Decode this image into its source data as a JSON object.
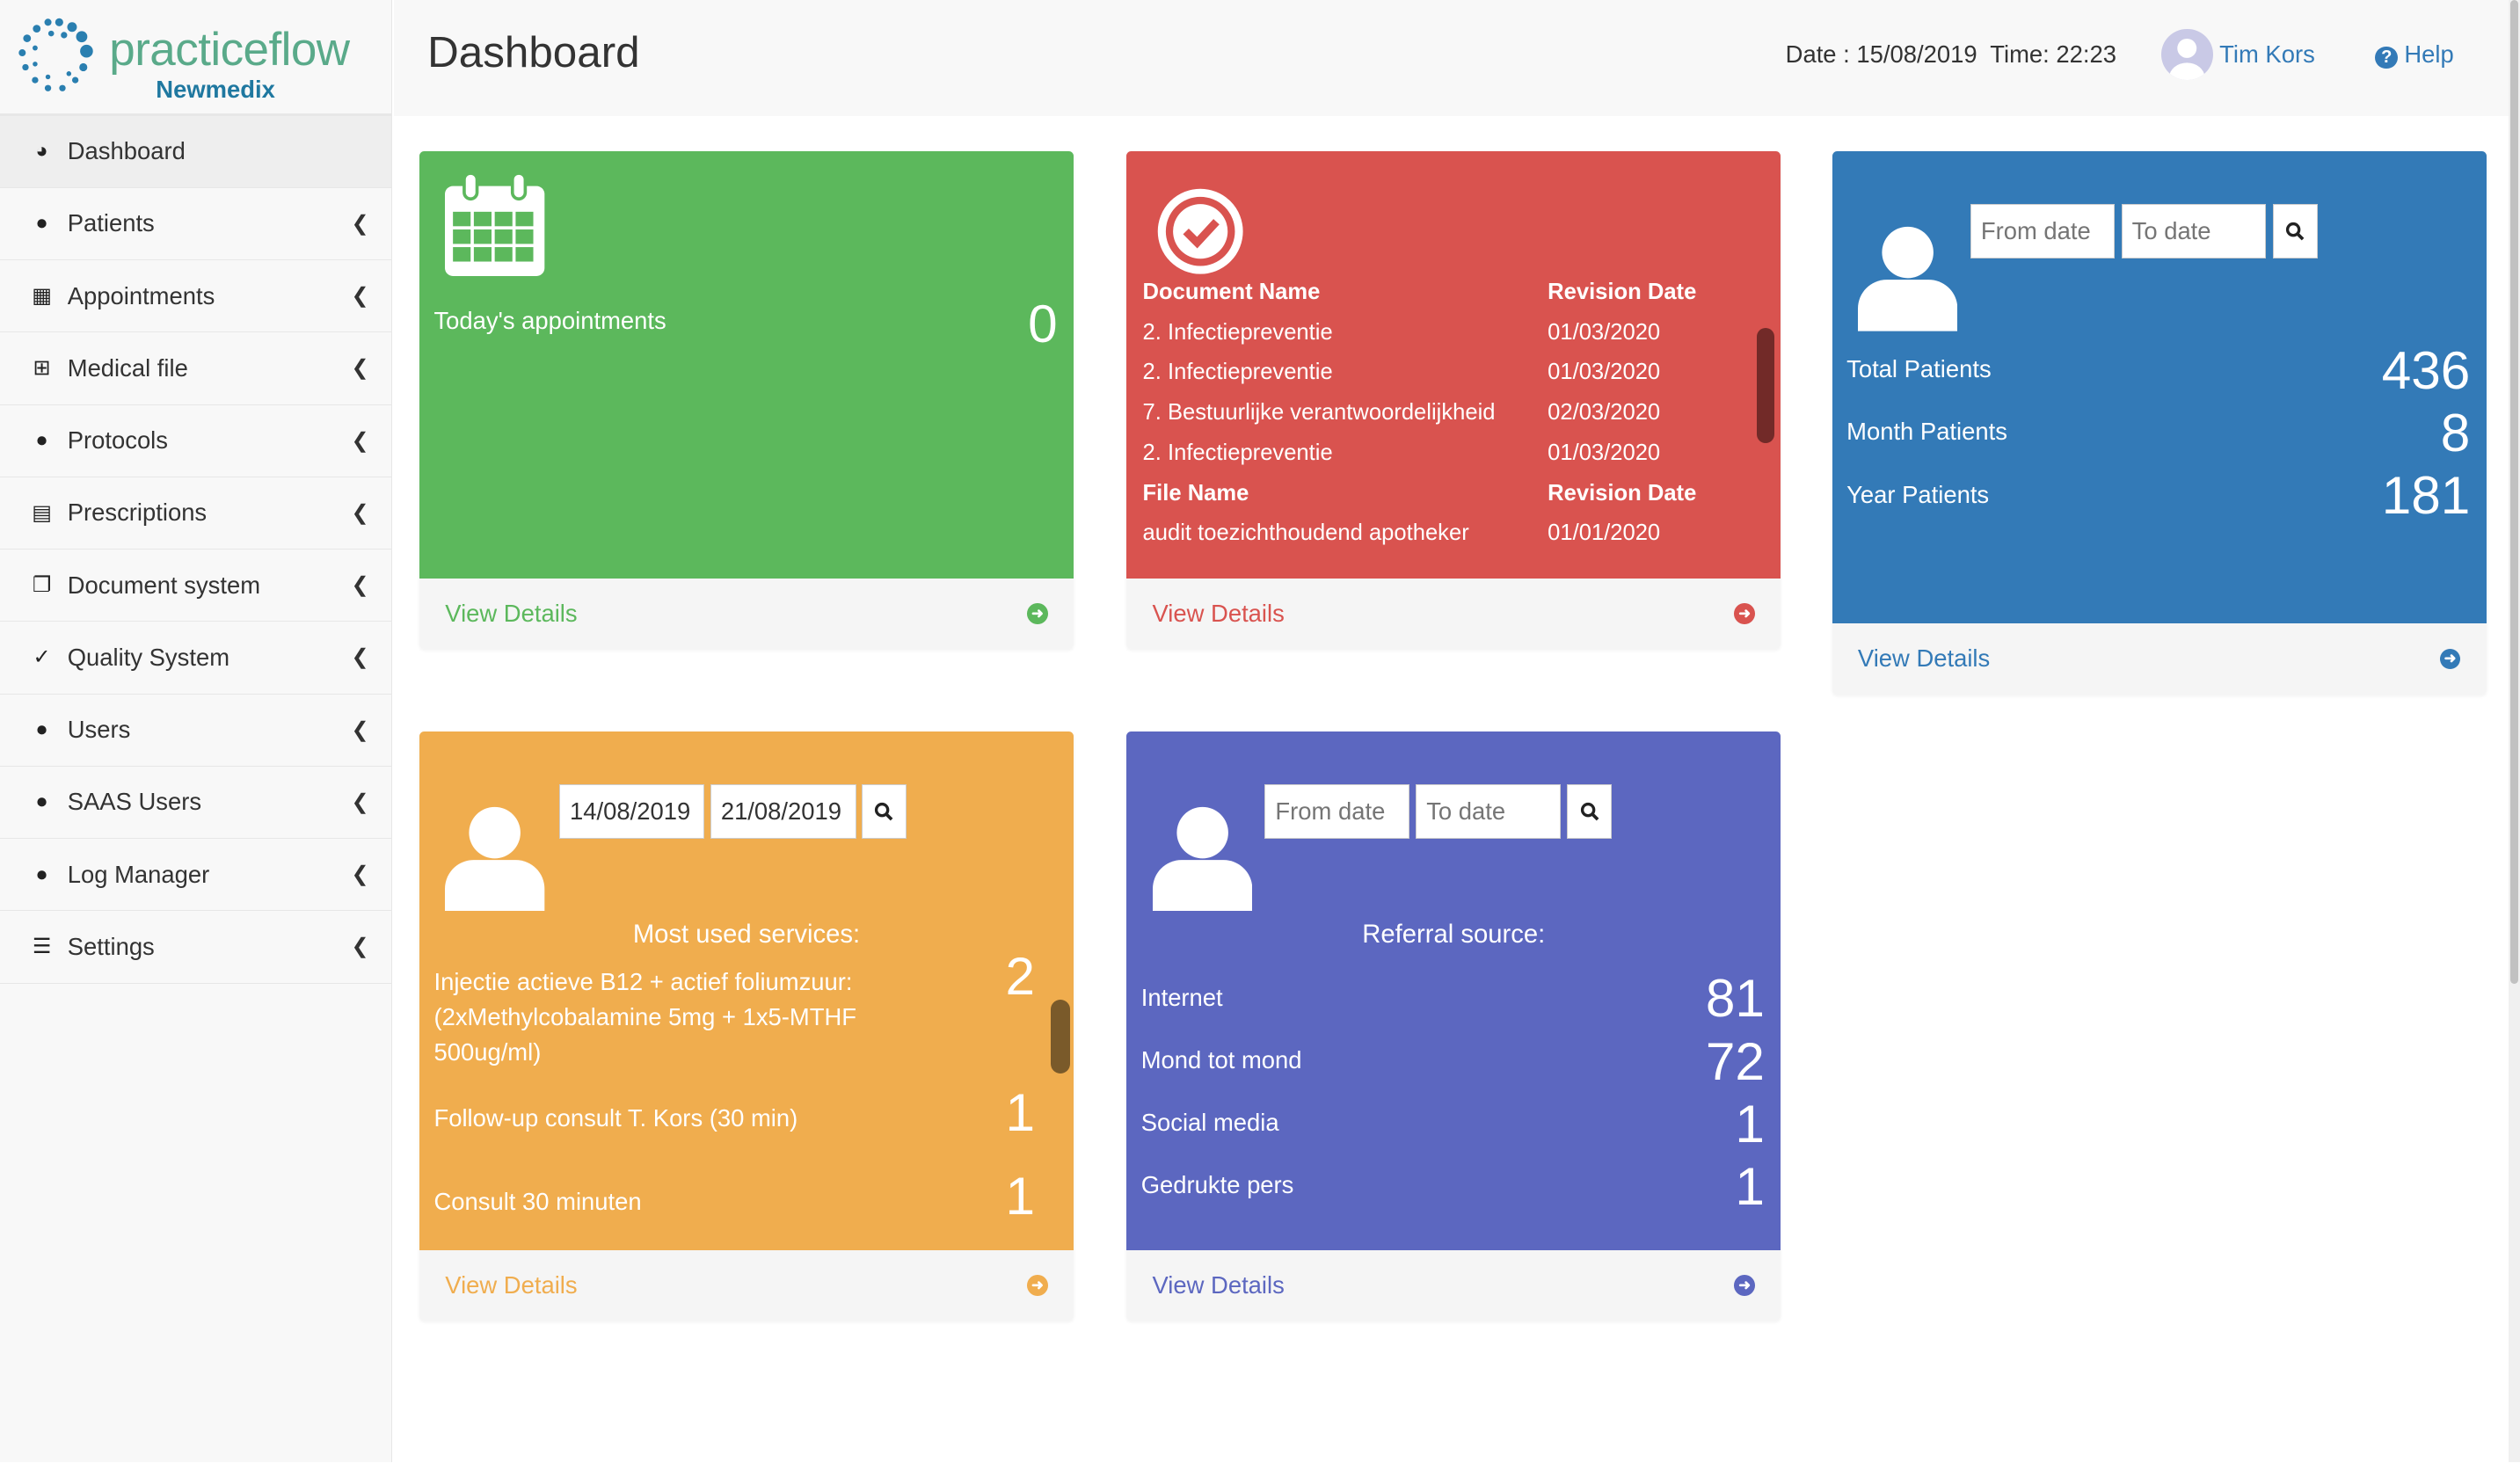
{
  "brand": {
    "name": "practiceflow",
    "subtitle": "Newmedix"
  },
  "header": {
    "title": "Dashboard",
    "datetime": "Date : 15/08/2019  Time: 22:23",
    "user": "Tim Kors",
    "help": "Help"
  },
  "sidebar": {
    "items": [
      {
        "label": "Dashboard",
        "icon": "dashboard-icon",
        "active": true
      },
      {
        "label": "Patients",
        "icon": "user-icon"
      },
      {
        "label": "Appointments",
        "icon": "calendar-icon"
      },
      {
        "label": "Medical file",
        "icon": "medical-file-icon"
      },
      {
        "label": "Protocols",
        "icon": "user-icon"
      },
      {
        "label": "Prescriptions",
        "icon": "clipboard-icon"
      },
      {
        "label": "Document system",
        "icon": "documents-icon"
      },
      {
        "label": "Quality System",
        "icon": "check-circle-icon"
      },
      {
        "label": "Users",
        "icon": "user-icon"
      },
      {
        "label": "SAAS Users",
        "icon": "user-icon"
      },
      {
        "label": "Log Manager",
        "icon": "user-icon"
      },
      {
        "label": "Settings",
        "icon": "list-icon"
      }
    ]
  },
  "appointments": {
    "label": "Today's appointments",
    "count": "0",
    "link": "View Details",
    "color": "#5cb85c"
  },
  "documents": {
    "color": "#d9534f",
    "link": "View Details",
    "doc_header": [
      "Document Name",
      "Revision Date"
    ],
    "docs": [
      [
        "2. Infectiepreventie",
        "01/03/2020"
      ],
      [
        "2. Infectiepreventie",
        "01/03/2020"
      ],
      [
        "7. Bestuurlijke verantwoordelijkheid",
        "02/03/2020"
      ],
      [
        "2. Infectiepreventie",
        "01/03/2020"
      ]
    ],
    "file_header": [
      "File Name",
      "Revision Date"
    ],
    "files": [
      [
        "audit toezichthoudend apotheker",
        "01/01/2020"
      ]
    ]
  },
  "patients": {
    "color": "#337ab7",
    "from_placeholder": "From date",
    "to_placeholder": "To date",
    "link": "View Details",
    "stats": [
      {
        "label": "Total Patients",
        "value": "436"
      },
      {
        "label": "Month Patients",
        "value": "8"
      },
      {
        "label": "Year Patients",
        "value": "181"
      }
    ]
  },
  "services": {
    "color": "#f0ad4e",
    "from": "14/08/2019",
    "to": "21/08/2019",
    "title": "Most used services:",
    "link": "View Details",
    "items": [
      {
        "label": "Injectie actieve B12 + actief foliumzuur: (2xMethylcobalamine 5mg + 1x5-MTHF 500ug/ml)",
        "value": "2"
      },
      {
        "label": "Follow-up consult T. Kors (30 min)",
        "value": "1"
      },
      {
        "label": "Consult 30 minuten",
        "value": "1"
      }
    ]
  },
  "referral": {
    "color": "#5c67c0",
    "from_placeholder": "From date",
    "to_placeholder": "To date",
    "title": "Referral source:",
    "link": "View Details",
    "items": [
      {
        "label": "Internet",
        "value": "81"
      },
      {
        "label": "Mond tot mond",
        "value": "72"
      },
      {
        "label": "Social media",
        "value": "1"
      },
      {
        "label": "Gedrukte pers",
        "value": "1"
      }
    ]
  }
}
